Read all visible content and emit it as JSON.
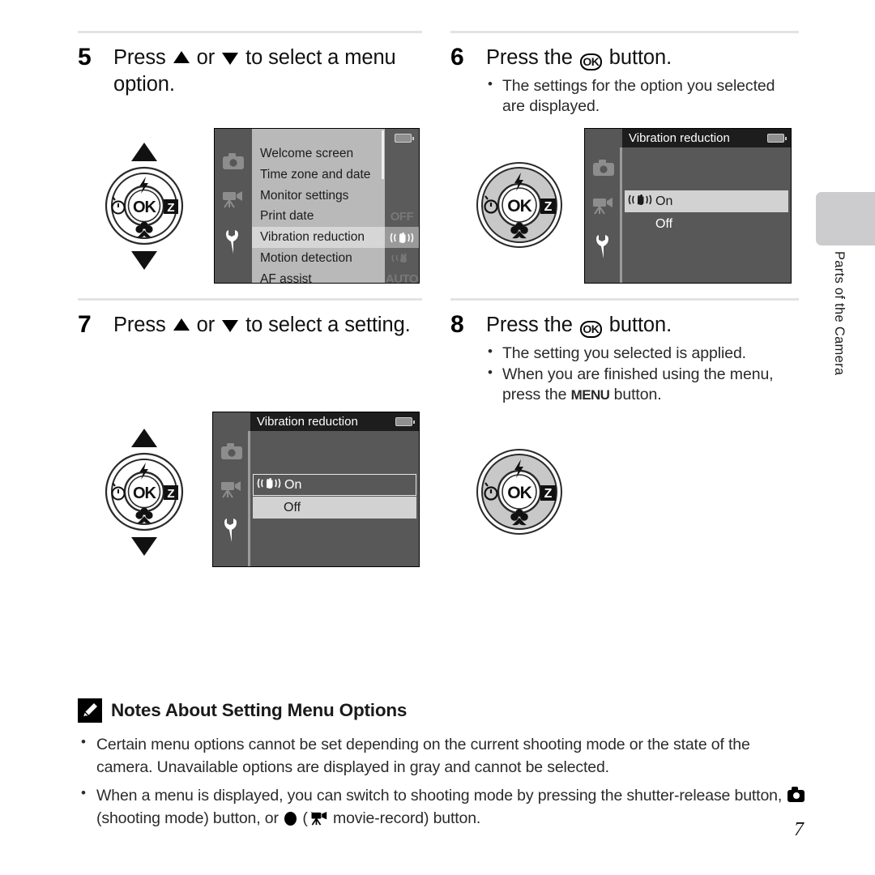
{
  "page": {
    "number": "7",
    "side_tab_label": "Parts of the Camera"
  },
  "steps": [
    {
      "number": "5",
      "text_parts": {
        "pre": "Press ",
        "mid": " or ",
        "post": " to select a menu option."
      },
      "instruction": "Press ▲ or ▼ to select a menu option.",
      "bullets": []
    },
    {
      "number": "6",
      "instruction": "Press the OK button.",
      "pre": "Press the ",
      "post": " button.",
      "bullets": [
        "The settings for the option you selected are displayed."
      ]
    },
    {
      "number": "7",
      "instruction": "Press ▲ or ▼ to select a setting.",
      "text_parts": {
        "pre": "Press ",
        "mid": " or ",
        "post": " to select a setting."
      },
      "bullets": []
    },
    {
      "number": "8",
      "instruction": "Press the OK button.",
      "pre": "Press the ",
      "post": " button.",
      "bullets_part1": "The setting you selected is applied.",
      "bullet2_pre": "When you are finished using the menu, press the ",
      "bullet2_menu": "MENU",
      "bullet2_post": " button."
    }
  ],
  "ok_button_label": "OK",
  "menu_button_label": "MENU",
  "setup_menu_screen": {
    "sidebar_icons": [
      "shooting-mode-icon",
      "movie-icon",
      "setup-wrench-icon"
    ],
    "items": [
      {
        "label": "Welcome screen",
        "right_icon": "",
        "selected": false
      },
      {
        "label": "Time zone and date",
        "right_icon": "",
        "selected": false
      },
      {
        "label": "Monitor settings",
        "right_icon": "",
        "selected": false
      },
      {
        "label": "Print date",
        "right_icon": "OFF",
        "selected": false
      },
      {
        "label": "Vibration reduction",
        "right_icon": "VR",
        "selected": true
      },
      {
        "label": "Motion detection",
        "right_icon": "MD",
        "selected": false
      },
      {
        "label": "AF assist",
        "right_icon": "AUTO",
        "selected": false
      }
    ]
  },
  "vr_screen_step6": {
    "title": "Vibration reduction",
    "options": [
      {
        "label": "On",
        "icon": "vr-icon",
        "state": "highlight"
      },
      {
        "label": "Off",
        "icon": "",
        "state": "none"
      }
    ]
  },
  "vr_screen_step7": {
    "title": "Vibration reduction",
    "options": [
      {
        "label": "On",
        "icon": "vr-icon",
        "state": "outline"
      },
      {
        "label": "Off",
        "icon": "",
        "state": "highlight"
      }
    ]
  },
  "notes": {
    "title": "Notes About Setting Menu Options",
    "items": [
      "Certain menu options cannot be set depending on the current shooting mode or the state of the camera. Unavailable options are displayed in gray and cannot be selected."
    ],
    "item2_pre": "When a menu is displayed, you can switch to shooting mode by pressing the shutter-release button, ",
    "item2_mid": " (shooting mode) button, or ",
    "item2_mid2": " (",
    "item2_post": " movie-record) button."
  },
  "colors": {
    "lcd_background": "#585858",
    "menu_list_bg": "#b9b9b9",
    "menu_selected_bg": "#d6d6d6",
    "title_bar": "#1d1d1d",
    "tab_gray": "#ccccce"
  }
}
